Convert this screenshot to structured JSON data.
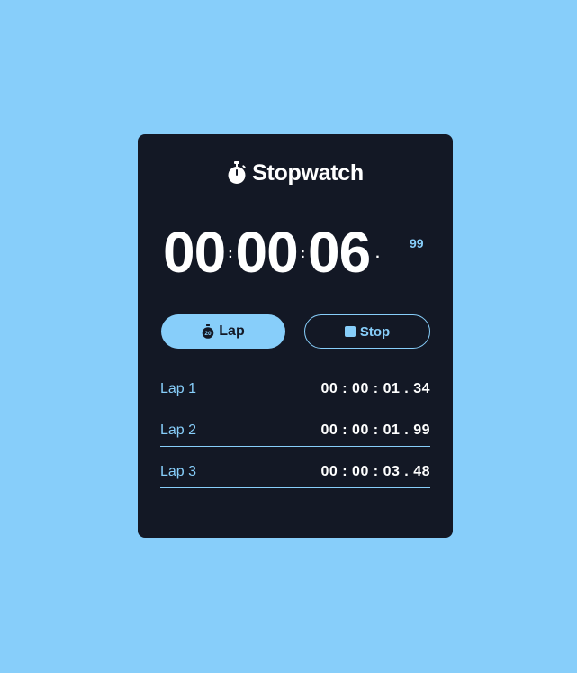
{
  "app": {
    "title": "Stopwatch",
    "icon": "stopwatch-icon"
  },
  "display": {
    "hours": "00",
    "minutes": "00",
    "seconds": "06",
    "centiseconds": "99",
    "colon": ":",
    "dot": "."
  },
  "controls": {
    "lap_label": "Lap",
    "lap_icon": "lap-timer-icon",
    "lap_icon_text": "20",
    "stop_label": "Stop",
    "stop_icon": "stop-icon"
  },
  "laps": [
    {
      "label": "Lap 1",
      "time": "00 : 00 : 01 . 34"
    },
    {
      "label": "Lap 2",
      "time": "00 : 00 : 01 . 99"
    },
    {
      "label": "Lap 3",
      "time": "00 : 00 : 03 . 48"
    }
  ],
  "colors": {
    "background": "#87cefa",
    "card": "#131825",
    "accent": "#87cefa",
    "text": "#ffffff"
  }
}
